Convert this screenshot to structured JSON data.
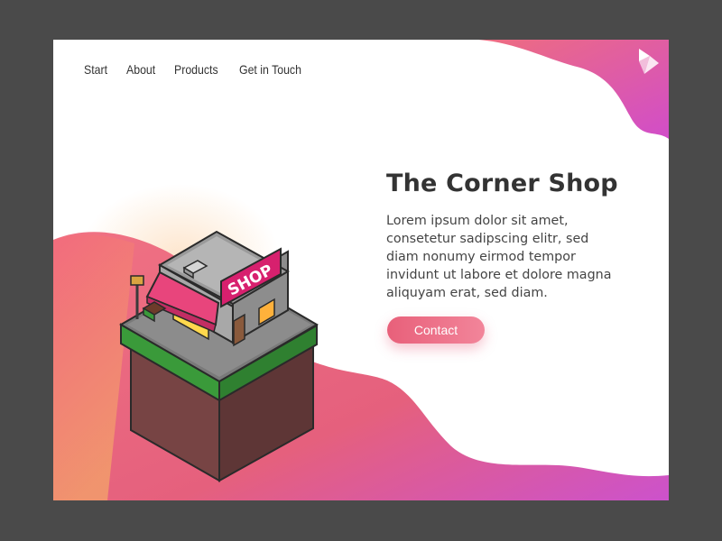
{
  "nav": {
    "items": [
      {
        "label": "Start"
      },
      {
        "label": "About"
      },
      {
        "label": "Products"
      },
      {
        "label": "Get in Touch"
      }
    ]
  },
  "hero": {
    "title": "The Corner Shop",
    "description": "Lorem ipsum dolor sit amet, consetetur sadipscing elitr, sed diam nonumy eirmod tempor invidunt ut labore et dolore magna aliquyam erat, sed diam.",
    "contact_label": "Contact"
  },
  "illustration": {
    "sign_text": "SHOP"
  },
  "colors": {
    "page_background": "#4a4a4a",
    "card_background": "#ffffff",
    "gradient_start": "#f07a7a",
    "gradient_end": "#d24fc8",
    "accent": "#e8607a",
    "heading_text": "#333333"
  },
  "icons": {
    "logo": "folded-triangles-logo-icon"
  }
}
